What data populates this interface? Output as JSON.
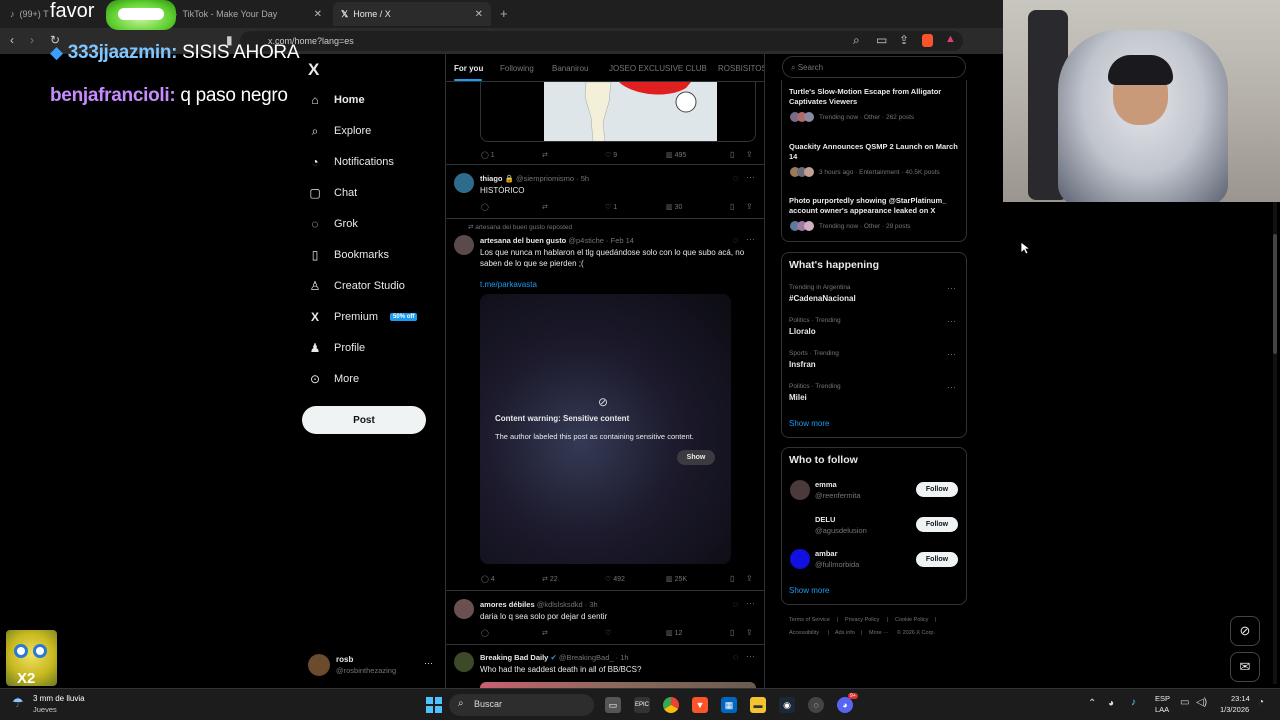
{
  "browser": {
    "tabs": [
      {
        "label": "(99+) T",
        "active": false
      },
      {
        "label": "TikTok - Make Your Day",
        "active": false
      },
      {
        "label": "Home / X",
        "active": true
      }
    ],
    "new_tab": "+",
    "url": "x.com/home?lang=es"
  },
  "stream_overlay": {
    "top_text": "favor",
    "chat": [
      {
        "user": "333jjaazmin:",
        "message": "SISIS AHORA"
      },
      {
        "user": "benjafrancioli:",
        "message": "q paso negro"
      }
    ],
    "emote_counter": "X2"
  },
  "x": {
    "logo": "X",
    "nav": [
      {
        "label": "Home",
        "icon": "home-icon"
      },
      {
        "label": "Explore",
        "icon": "search-icon"
      },
      {
        "label": "Notifications",
        "icon": "bell-icon"
      },
      {
        "label": "Chat",
        "icon": "chat-icon"
      },
      {
        "label": "Grok",
        "icon": "grok-icon"
      },
      {
        "label": "Bookmarks",
        "icon": "bookmark-icon"
      },
      {
        "label": "Creator Studio",
        "icon": "creator-icon"
      },
      {
        "label": "Premium",
        "icon": "x-icon",
        "badge": "50% off"
      },
      {
        "label": "Profile",
        "icon": "person-icon"
      },
      {
        "label": "More",
        "icon": "more-circle-icon"
      }
    ],
    "post_button": "Post",
    "account": {
      "name": "rosb",
      "handle": "@rosbinthezazing"
    },
    "feed_tabs": [
      "For you",
      "Following",
      "Bananirou",
      "JOSEO EXCLUSIVE CLUB",
      "ROSBISITOS"
    ],
    "posts": [
      {
        "id": "p0",
        "actions": {
          "reply": "1",
          "repost": "",
          "like": "9",
          "views": "495"
        }
      },
      {
        "id": "p1",
        "name": "thiago",
        "handle": "@siempriomismo",
        "time": "· 5h",
        "text": "HISTÓRICO",
        "actions": {
          "reply": "",
          "repost": "",
          "like": "1",
          "views": "30"
        }
      },
      {
        "id": "p2",
        "repost_note": "artesana del buen gusto reposted",
        "name": "artesana del buen gusto",
        "handle": "@p4stiche",
        "time": "· Feb 14",
        "text": "Los que nunca m hablaron el tlg quedándose solo con lo que subo acá, no saben de lo que se pierden ;(",
        "link": "t.me/parkavasta",
        "warning_title": "Content warning: Sensitive content",
        "warning_body": "The author labeled this post as containing sensitive content.",
        "show_button": "Show",
        "actions": {
          "reply": "4",
          "repost": "22",
          "like": "492",
          "views": "25K"
        }
      },
      {
        "id": "p3",
        "name": "amores débiles",
        "handle": "@kdlslsksdkd",
        "time": "· 3h",
        "text": "daria lo q sea solo por dejar d sentir",
        "actions": {
          "reply": "",
          "repost": "",
          "like": "",
          "views": "12"
        }
      },
      {
        "id": "p4",
        "name": "Breaking Bad Daily",
        "handle": "@BreakingBad_",
        "time": "· 1h",
        "text": "Who had the saddest death in all of BB/BCS?"
      }
    ],
    "search_placeholder": "Search",
    "news": [
      {
        "title": "Turtle's Slow-Motion Escape from Alligator Captivates Viewers",
        "meta": "Trending now · Other · 262 posts"
      },
      {
        "title": "Quackity Announces QSMP 2 Launch on March 14",
        "meta": "3 hours ago · Entertainment · 40.5K posts"
      },
      {
        "title": "Photo purportedly showing @StarPlatinum_ account owner's appearance leaked on X",
        "meta": "Trending now · Other · 29 posts"
      }
    ],
    "whats_happening": {
      "title": "What's happening",
      "trends": [
        {
          "category": "Trending in Argentina",
          "name": "#CadenaNacional"
        },
        {
          "category": "Politics · Trending",
          "name": "Lloralo"
        },
        {
          "category": "Sports · Trending",
          "name": "Insfran"
        },
        {
          "category": "Politics · Trending",
          "name": "Milei"
        }
      ],
      "show_more": "Show more"
    },
    "who_to_follow": {
      "title": "Who to follow",
      "users": [
        {
          "name": "emma",
          "handle": "@reenfermita"
        },
        {
          "name": "DELU",
          "handle": "@agusdelusion"
        },
        {
          "name": "ambar",
          "handle": "@fullmorbida"
        }
      ],
      "follow_label": "Follow",
      "show_more": "Show more"
    },
    "footer": [
      "Terms of Service",
      "|",
      "Privacy Policy",
      "|",
      "Cookie Policy",
      "|",
      "Accessibility",
      "|",
      "Ads info",
      "|",
      "More ···",
      "© 2026 X Corp."
    ]
  },
  "taskbar": {
    "weather_temp": "3 mm de lluvia",
    "weather_day": "Jueves",
    "search": "Buscar",
    "lang": "ESP",
    "lang2": "LAA",
    "time": "23:14",
    "date": "1/3/2026",
    "discord_badge": "9+"
  },
  "colors": {
    "accent": "#1d9bf0",
    "bg": "#000000",
    "border": "#2f3336",
    "muted": "#71767b"
  }
}
